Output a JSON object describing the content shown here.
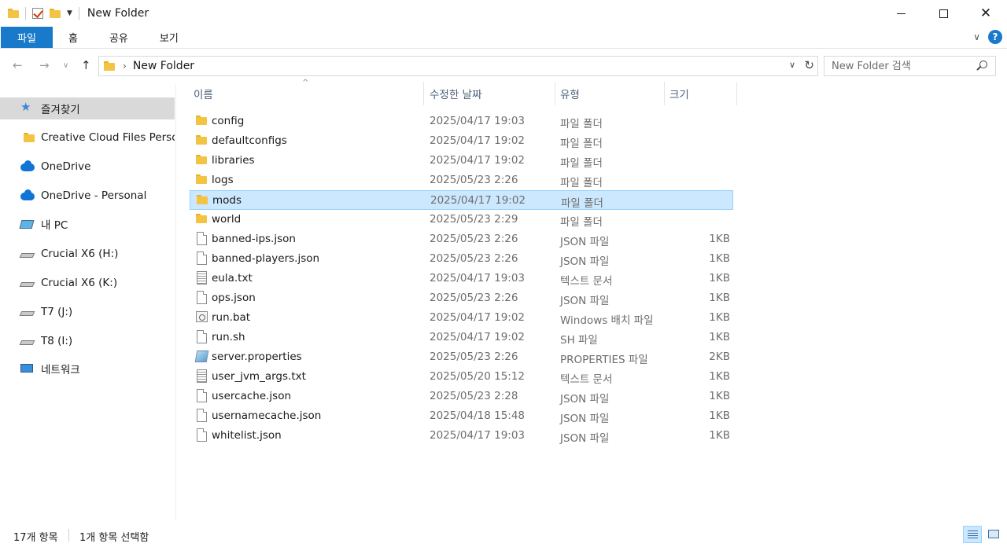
{
  "window": {
    "title": "New Folder"
  },
  "ribbon": {
    "tabs": [
      "파일",
      "홈",
      "공유",
      "보기"
    ]
  },
  "address": {
    "crumb": "New Folder"
  },
  "search": {
    "placeholder": "New Folder 검색"
  },
  "sidebar": {
    "items": [
      {
        "label": "즐겨찾기",
        "icon": "star-icon"
      },
      {
        "label": "Creative Cloud Files Personal",
        "icon": "folder-icon"
      },
      {
        "label": "OneDrive",
        "icon": "cloud-icon"
      },
      {
        "label": "OneDrive - Personal",
        "icon": "cloud-icon"
      },
      {
        "label": "내 PC",
        "icon": "pc-icon"
      },
      {
        "label": "Crucial X6 (H:)",
        "icon": "drive-icon"
      },
      {
        "label": "Crucial X6 (K:)",
        "icon": "drive-icon"
      },
      {
        "label": "T7 (J:)",
        "icon": "drive-icon"
      },
      {
        "label": "T8 (I:)",
        "icon": "drive-icon"
      },
      {
        "label": "네트워크",
        "icon": "network-icon"
      }
    ]
  },
  "columns": {
    "name": "이름",
    "modified": "수정한 날짜",
    "type": "유형",
    "size": "크기"
  },
  "files": [
    {
      "name": "config",
      "modified": "2025/04/17 19:03",
      "type": "파일 폴더",
      "size": "",
      "icon": "folder-icon"
    },
    {
      "name": "defaultconfigs",
      "modified": "2025/04/17 19:02",
      "type": "파일 폴더",
      "size": "",
      "icon": "folder-icon"
    },
    {
      "name": "libraries",
      "modified": "2025/04/17 19:02",
      "type": "파일 폴더",
      "size": "",
      "icon": "folder-icon"
    },
    {
      "name": "logs",
      "modified": "2025/05/23 2:26",
      "type": "파일 폴더",
      "size": "",
      "icon": "folder-icon"
    },
    {
      "name": "mods",
      "modified": "2025/04/17 19:02",
      "type": "파일 폴더",
      "size": "",
      "icon": "folder-icon"
    },
    {
      "name": "world",
      "modified": "2025/05/23 2:29",
      "type": "파일 폴더",
      "size": "",
      "icon": "folder-icon"
    },
    {
      "name": "banned-ips.json",
      "modified": "2025/05/23 2:26",
      "type": "JSON 파일",
      "size": "1KB",
      "icon": "file-icon"
    },
    {
      "name": "banned-players.json",
      "modified": "2025/05/23 2:26",
      "type": "JSON 파일",
      "size": "1KB",
      "icon": "file-icon"
    },
    {
      "name": "eula.txt",
      "modified": "2025/04/17 19:03",
      "type": "텍스트 문서",
      "size": "1KB",
      "icon": "text-file-icon"
    },
    {
      "name": "ops.json",
      "modified": "2025/05/23 2:26",
      "type": "JSON 파일",
      "size": "1KB",
      "icon": "file-icon"
    },
    {
      "name": "run.bat",
      "modified": "2025/04/17 19:02",
      "type": "Windows 배치 파일",
      "size": "1KB",
      "icon": "batch-file-icon"
    },
    {
      "name": "run.sh",
      "modified": "2025/04/17 19:02",
      "type": "SH 파일",
      "size": "1KB",
      "icon": "file-icon"
    },
    {
      "name": "server.properties",
      "modified": "2025/05/23 2:26",
      "type": "PROPERTIES 파일",
      "size": "2KB",
      "icon": "properties-file-icon"
    },
    {
      "name": "user_jvm_args.txt",
      "modified": "2025/05/20 15:12",
      "type": "텍스트 문서",
      "size": "1KB",
      "icon": "text-file-icon"
    },
    {
      "name": "usercache.json",
      "modified": "2025/05/23 2:28",
      "type": "JSON 파일",
      "size": "1KB",
      "icon": "file-icon"
    },
    {
      "name": "usernamecache.json",
      "modified": "2025/04/18 15:48",
      "type": "JSON 파일",
      "size": "1KB",
      "icon": "file-icon"
    },
    {
      "name": "whitelist.json",
      "modified": "2025/04/17 19:03",
      "type": "JSON 파일",
      "size": "1KB",
      "icon": "file-icon"
    }
  ],
  "selected_file": "mods",
  "status": {
    "count": "17개 항목",
    "selection": "1개 항목 선택함"
  },
  "colors": {
    "accent": "#1979ca",
    "selection_bg": "#cce8ff",
    "selection_border": "#99d1ff",
    "folder": "#f3c443"
  }
}
